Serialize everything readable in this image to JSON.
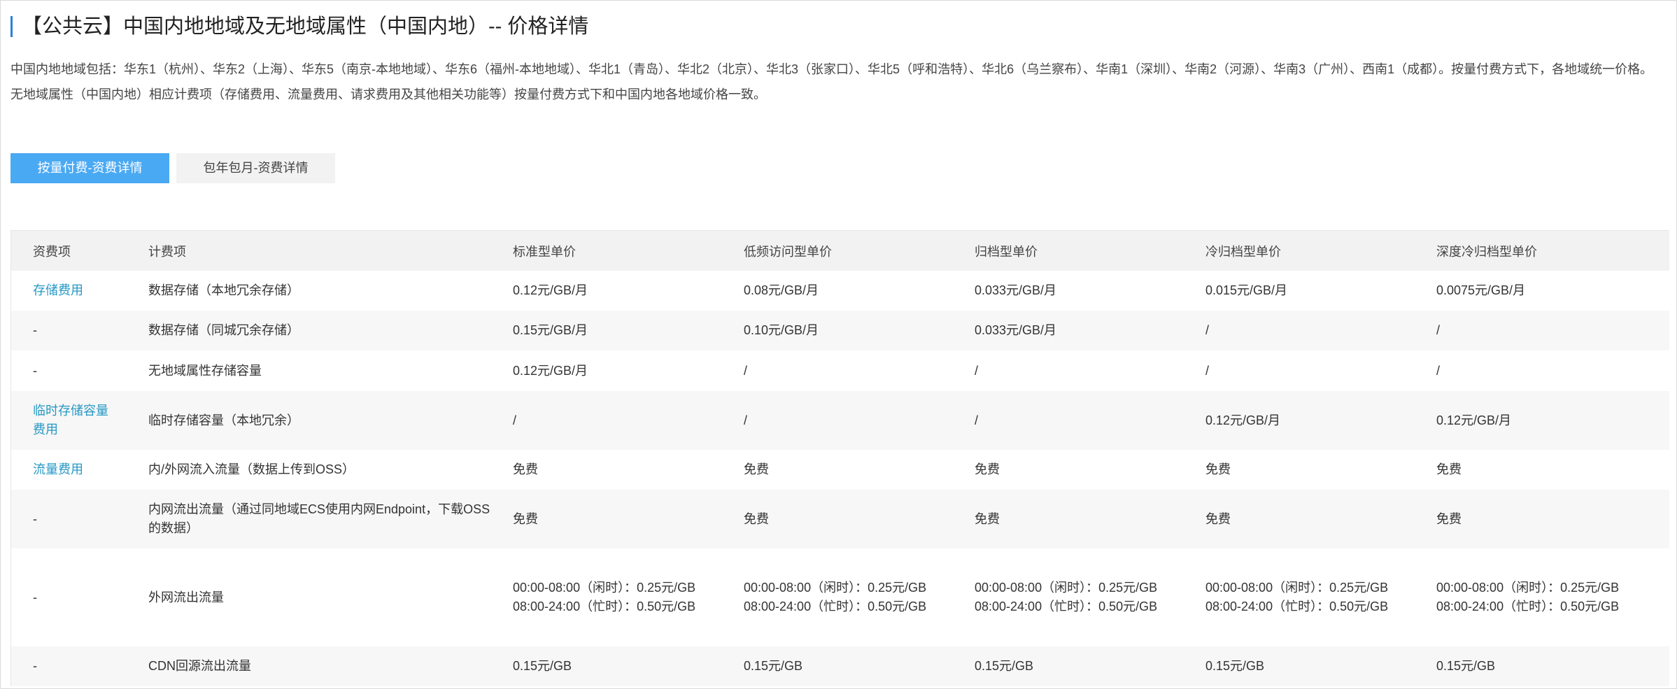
{
  "title": "【公共云】中国内地地域及无地域属性（中国内地）-- 价格详情",
  "description": {
    "line1": "中国内地地域包括：华东1（杭州）、华东2（上海）、华东5（南京-本地地域）、华东6（福州-本地地域）、华北1（青岛）、华北2（北京）、华北3（张家口）、华北5（呼和浩特）、华北6（乌兰察布）、华南1（深圳）、华南2（河源）、华南3（广州）、西南1（成都）。按量付费方式下，各地域统一价格。",
    "line2": "无地域属性（中国内地）相应计费项（存储费用、流量费用、请求费用及其他相关功能等）按量付费方式下和中国内地各地域价格一致。"
  },
  "tabs": [
    {
      "label": "按量付费-资费详情",
      "active": true
    },
    {
      "label": "包年包月-资费详情",
      "active": false
    }
  ],
  "table": {
    "headers": [
      "资费项",
      "计费项",
      "标准型单价",
      "低频访问型单价",
      "归档型单价",
      "冷归档型单价",
      "深度冷归档型单价"
    ],
    "rows": [
      {
        "item": "存储费用",
        "item_link": true,
        "billing": "数据存储（本地冗余存储）",
        "prices": [
          "0.12元/GB/月",
          "0.08元/GB/月",
          "0.033元/GB/月",
          "0.015元/GB/月",
          "0.0075元/GB/月"
        ]
      },
      {
        "item": "-",
        "item_link": false,
        "billing": "数据存储（同城冗余存储）",
        "prices": [
          "0.15元/GB/月",
          "0.10元/GB/月",
          "0.033元/GB/月",
          "/",
          "/"
        ]
      },
      {
        "item": "-",
        "item_link": false,
        "billing": "无地域属性存储容量",
        "prices": [
          "0.12元/GB/月",
          "/",
          "/",
          "/",
          "/"
        ]
      },
      {
        "item": "临时存储容量费用",
        "item_link": true,
        "billing": "临时存储容量（本地冗余）",
        "prices": [
          "/",
          "/",
          "/",
          "0.12元/GB/月",
          "0.12元/GB/月"
        ]
      },
      {
        "item": "流量费用",
        "item_link": true,
        "billing": "内/外网流入流量（数据上传到OSS）",
        "prices": [
          "免费",
          "免费",
          "免费",
          "免费",
          "免费"
        ]
      },
      {
        "item": "-",
        "item_link": false,
        "billing": "内网流出流量（通过同地域ECS使用内网Endpoint，下载OSS的数据）",
        "prices": [
          "免费",
          "免费",
          "免费",
          "免费",
          "免费"
        ]
      },
      {
        "item": "-",
        "item_link": false,
        "billing": "外网流出流量",
        "prices": [
          "00:00-08:00（闲时）：0.25元/GB\n08:00-24:00（忙时）：0.50元/GB",
          "00:00-08:00（闲时）：0.25元/GB\n08:00-24:00（忙时）：0.50元/GB",
          "00:00-08:00（闲时）：0.25元/GB\n08:00-24:00（忙时）：0.50元/GB",
          "00:00-08:00（闲时）：0.25元/GB\n08:00-24:00（忙时）：0.50元/GB",
          "00:00-08:00（闲时）：0.25元/GB\n08:00-24:00（忙时）：0.50元/GB"
        ]
      },
      {
        "item": "-",
        "item_link": false,
        "billing": "CDN回源流出流量",
        "prices": [
          "0.15元/GB",
          "0.15元/GB",
          "0.15元/GB",
          "0.15元/GB",
          "0.15元/GB"
        ]
      }
    ]
  }
}
